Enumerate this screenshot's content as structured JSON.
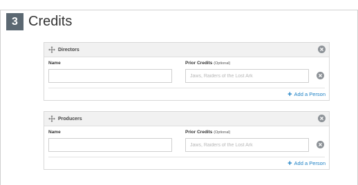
{
  "step": {
    "number": "3",
    "title": "Credits"
  },
  "panels": [
    {
      "title": "Directors",
      "name_label": "Name",
      "prior_label": "Prior Credits",
      "prior_optional": "(Optional)",
      "name_value": "",
      "prior_placeholder": "Jaws, Raiders of the Lost Ark",
      "add_label": "Add a Person"
    },
    {
      "title": "Producers",
      "name_label": "Name",
      "prior_label": "Prior Credits",
      "prior_optional": "(Optional)",
      "name_value": "",
      "prior_placeholder": "Jaws, Raiders of the Lost Ark",
      "add_label": "Add a Person"
    }
  ],
  "icons": {
    "move": "move-icon",
    "remove": "close-circle-icon",
    "add": "plus-icon"
  },
  "colors": {
    "badge": "#5b6872",
    "link": "#1a7fc4",
    "header_bg": "#f1f1f1",
    "remove_icon": "#8e9398"
  }
}
